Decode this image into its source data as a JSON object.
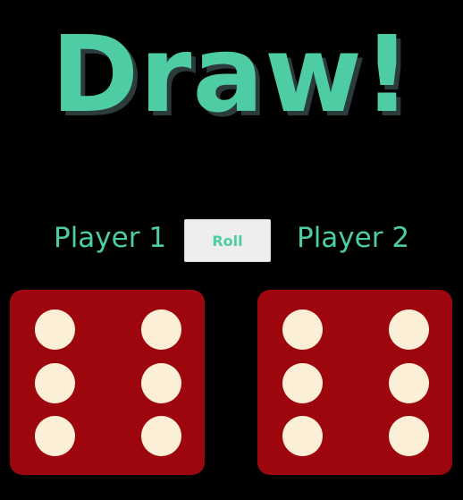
{
  "title": "Draw!",
  "players": {
    "left_label": "Player 1",
    "right_label": "Player 2"
  },
  "controls": {
    "roll_label": "Roll"
  },
  "dice": [
    {
      "player": "Player 1",
      "value": 6
    },
    {
      "player": "Player 2",
      "value": 6
    }
  ],
  "colors": {
    "background": "#000000",
    "accent": "#4ecca3",
    "title_shadow": "#2b3a3a",
    "die_face": "#9e060e",
    "pip": "#fbefd8",
    "button_bg": "#eeeeee"
  }
}
